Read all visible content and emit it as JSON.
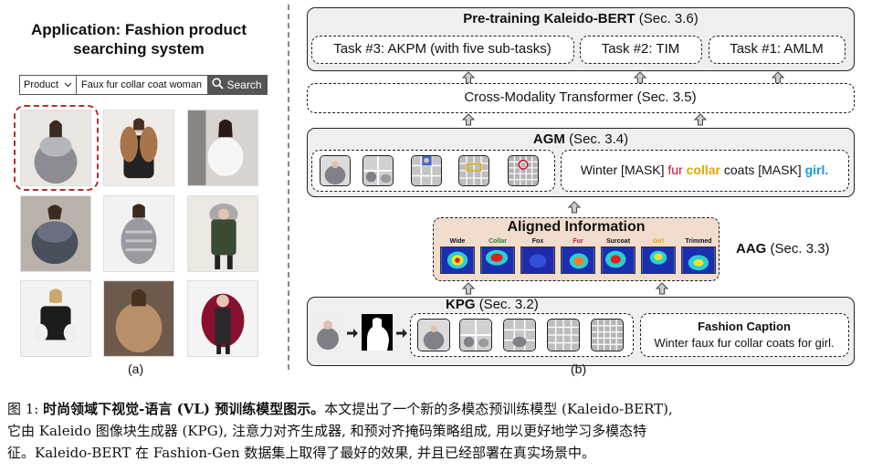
{
  "panel_a": {
    "title_line1": "Application: Fashion product",
    "title_line2": "searching system",
    "search": {
      "category": "Product",
      "query": "Faux fur collar coat woman",
      "button": "Search"
    },
    "label": "(a)"
  },
  "panel_b": {
    "pretrain": {
      "title": "Pre-training Kaleido-BERT",
      "sec": "(Sec. 3.6)"
    },
    "tasks": [
      "Task #3: AKPM (with five sub-tasks)",
      "Task #2: TIM",
      "Task #1: AMLM"
    ],
    "transformer": "Cross-Modality Transformer (Sec. 3.5)",
    "agm": {
      "title": "AGM",
      "sec": "(Sec. 3.4)"
    },
    "masked_caption": [
      {
        "text": "Winter [MASK] ",
        "color": "#111111"
      },
      {
        "text": "fur ",
        "color": "#c8102e"
      },
      {
        "text": "collar ",
        "color": "#e0a800"
      },
      {
        "text": "coats [MASK] ",
        "color": "#111111"
      },
      {
        "text": "girl.",
        "color": "#1a9ad6"
      }
    ],
    "aligned": {
      "title": "Aligned Information",
      "words": [
        {
          "word": "Wide",
          "color": "#111111"
        },
        {
          "word": "Collar",
          "color": "#2a7d2a"
        },
        {
          "word": "Fox",
          "color": "#111111"
        },
        {
          "word": "Fur",
          "color": "#c8102e"
        },
        {
          "word": "Surcoat",
          "color": "#111111"
        },
        {
          "word": "Girl",
          "color": "#e0a800"
        },
        {
          "word": "Trimmed",
          "color": "#111111"
        }
      ]
    },
    "aag": {
      "title": "AAG",
      "sec": "(Sec. 3.3)"
    },
    "kpg": {
      "title": "KPG",
      "sec": "(Sec. 3.2)"
    },
    "fashion_caption": {
      "title": "Fashion Caption",
      "text": "Winter faux fur collar coats for girl."
    },
    "label": "(b)"
  },
  "caption": {
    "line1_prefix": "图 1: ",
    "line1_bold": "时尚领域下视觉-语言 (VL) 预训练模型图示。",
    "line1_rest": "本文提出了一个新的多模态预训练模型 (Kaleido-BERT),",
    "line2": "它由 Kaleido 图像块生成器 (KPG), 注意力对齐生成器, 和预对齐掩码策略组成, 用以更好地学习多模态特",
    "line3": "征。Kaleido-BERT 在 Fashion-Gen 数据集上取得了最好的效果, 并且已经部署在真实场景中。"
  },
  "colors": {
    "box_fill": "#efefef",
    "aligned_fill": "#f1dccd",
    "highlight": "#b03030",
    "search_button": "#555555"
  },
  "icons": [
    "chevron-down-icon",
    "search-icon",
    "arrow-up-icon",
    "arrow-right-icon"
  ]
}
